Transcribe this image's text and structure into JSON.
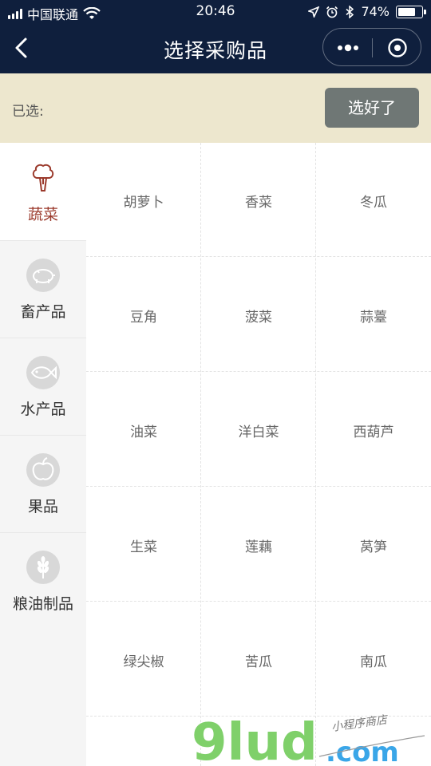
{
  "status_bar": {
    "carrier": "中国联通",
    "time": "20:46",
    "battery": "74%",
    "battery_level": 0.74
  },
  "nav": {
    "title": "选择采购品"
  },
  "selection": {
    "label": "已选:",
    "confirm_label": "选好了"
  },
  "categories": [
    {
      "label": "蔬菜",
      "icon": "broccoli-icon",
      "active": true
    },
    {
      "label": "畜产品",
      "icon": "pig-icon",
      "active": false
    },
    {
      "label": "水产品",
      "icon": "fish-icon",
      "active": false
    },
    {
      "label": "果品",
      "icon": "apple-icon",
      "active": false
    },
    {
      "label": "粮油制品",
      "icon": "wheat-icon",
      "active": false
    }
  ],
  "products": [
    "胡萝卜",
    "香菜",
    "冬瓜",
    "豆角",
    "菠菜",
    "蒜薹",
    "油菜",
    "洋白菜",
    "西葫芦",
    "生菜",
    "莲藕",
    "莴笋",
    "绿尖椒",
    "苦瓜",
    "南瓜"
  ],
  "watermark": {
    "brand": "9lud",
    "domain": ".com",
    "tagline": "小程序商店"
  },
  "colors": {
    "header_bg": "#0f1f3d",
    "selection_bg": "#ede7ce",
    "button_bg": "#6f7775",
    "active_category": "#9b3a2c",
    "watermark_green": "#7fd06a",
    "watermark_blue": "#3aa6e8"
  }
}
